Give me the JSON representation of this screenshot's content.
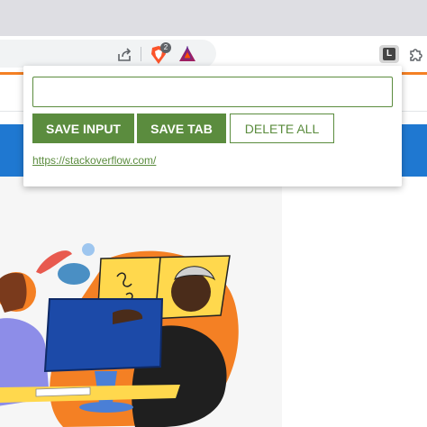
{
  "browser": {
    "icons": [
      "share-icon",
      "brave-shields-icon",
      "bat-rewards-icon",
      "extension-l-icon",
      "puzzle-icon"
    ],
    "shields_badge": "2",
    "extension_letter": "L"
  },
  "popup": {
    "input": {
      "value": "",
      "placeholder": ""
    },
    "buttons": {
      "save_input": "SAVE INPUT",
      "save_tab": "SAVE TAB",
      "delete_all": "DELETE ALL"
    },
    "leads": [
      {
        "url": "https://stackoverflow.com/"
      }
    ],
    "accent_color": "#5b8c3e"
  },
  "page": {
    "accent_orange": "#f48024",
    "banner_blue": "#1f78d1"
  }
}
